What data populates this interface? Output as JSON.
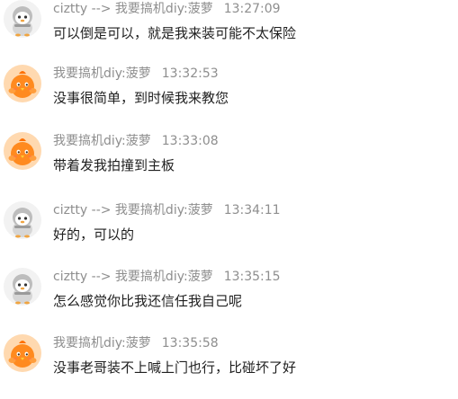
{
  "colors": {
    "meta_text": "#8e8e8e",
    "body_text": "#1f1f1f",
    "background": "#ffffff"
  },
  "messages": [
    {
      "sender": "ciztty --> 我要搞机diy:菠萝",
      "time": "13:27:09",
      "text": "可以倒是可以，就是我来装可能不太保险",
      "avatar": "gray-penguin-avatar"
    },
    {
      "sender": "我要搞机diy:菠萝",
      "time": "13:32:53",
      "text": "没事很简单，到时候我来教您",
      "avatar": "orange-bird-avatar"
    },
    {
      "sender": "我要搞机diy:菠萝",
      "time": "13:33:08",
      "text": "带着发我拍撞到主板",
      "avatar": "orange-bird-avatar"
    },
    {
      "sender": "ciztty --> 我要搞机diy:菠萝",
      "time": "13:34:11",
      "text": "好的，可以的",
      "avatar": "gray-penguin-avatar"
    },
    {
      "sender": "ciztty --> 我要搞机diy:菠萝",
      "time": "13:35:15",
      "text": "怎么感觉你比我还信任我自己呢",
      "avatar": "gray-penguin-avatar"
    },
    {
      "sender": "我要搞机diy:菠萝",
      "time": "13:35:58",
      "text": "没事老哥装不上喊上门也行，比碰坏了好",
      "avatar": "orange-bird-avatar"
    }
  ]
}
